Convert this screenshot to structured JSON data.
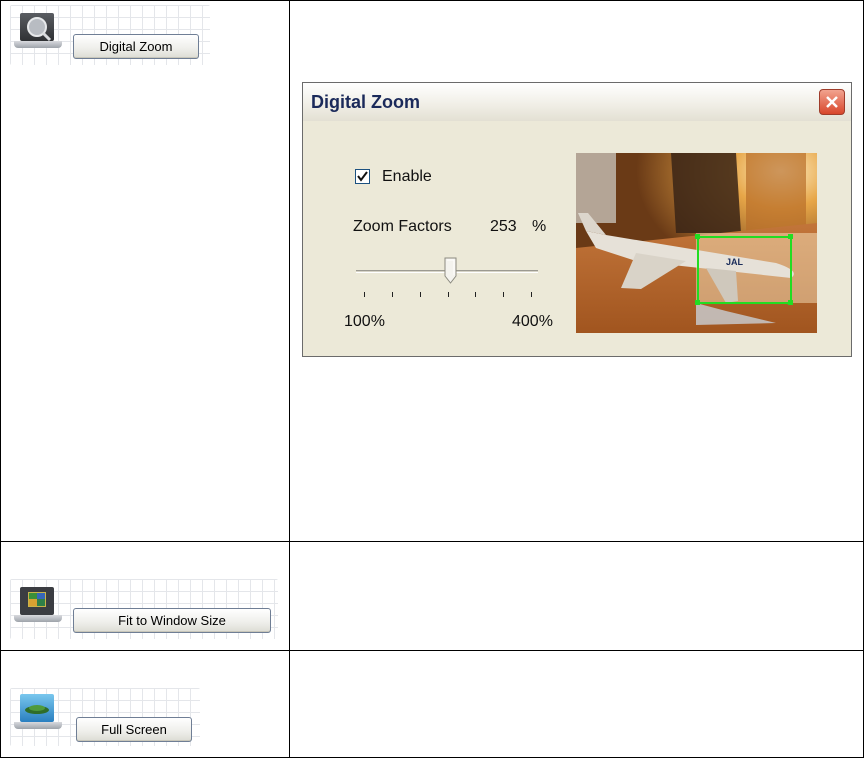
{
  "rows": [
    {
      "button_label": "Digital Zoom",
      "icon": "magnifier-laptop-icon"
    },
    {
      "button_label": "Fit to Window Size",
      "icon": "fit-window-laptop-icon"
    },
    {
      "button_label": "Full Screen",
      "icon": "fullscreen-laptop-icon"
    }
  ],
  "dialog": {
    "title": "Digital Zoom",
    "close_icon": "close-icon",
    "enable_label": "Enable",
    "enable_checked": true,
    "zoom_factors_label": "Zoom Factors",
    "zoom_value": "253",
    "zoom_unit": "%",
    "slider_min_label": "100%",
    "slider_max_label": "400%",
    "slider_value_fraction": 0.51,
    "preview_description": "camera-preview"
  },
  "colors": {
    "dialog_bg": "#ece9d8",
    "title_text": "#1b2a5a",
    "close_button": "#d8462b",
    "zoom_rect": "#22dd22"
  }
}
